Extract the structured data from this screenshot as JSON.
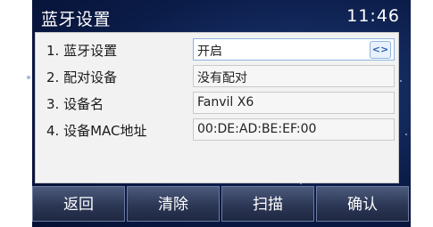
{
  "header": {
    "title": "蓝牙设置",
    "time": "11:46"
  },
  "menu": {
    "rows": [
      {
        "label": "1. 蓝牙设置",
        "value": "开启"
      },
      {
        "label": "2. 配对设备",
        "value": "没有配对"
      },
      {
        "label": "3. 设备名",
        "value": "Fanvil X6"
      },
      {
        "label": "4. 设备MAC地址",
        "value": "00:DE:AD:BE:EF:00"
      }
    ],
    "selector_glyph": "<>"
  },
  "softkeys": [
    "返回",
    "清除",
    "扫描",
    "确认"
  ],
  "colors": {
    "background": "#0b1c48",
    "panel": "#f2f2f2",
    "highlight": "#8fb4e0"
  }
}
